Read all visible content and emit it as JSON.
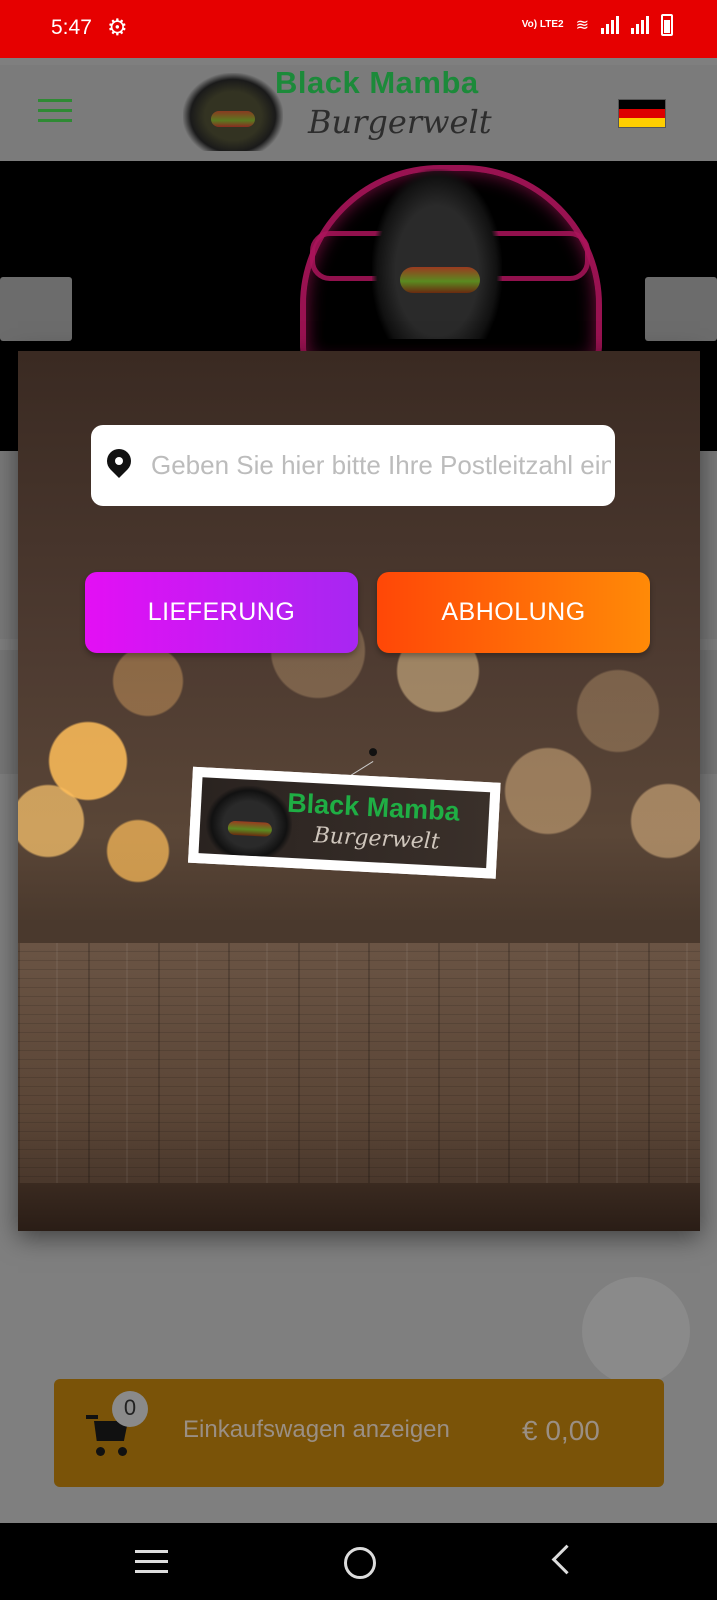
{
  "status_bar": {
    "time": "5:47",
    "settings_icon": "gear-icon",
    "volte_label": "Vo) LTE2",
    "icons": [
      "wifi-icon",
      "signal-icon",
      "signal-icon",
      "battery-icon"
    ]
  },
  "header": {
    "brand_name": "Black Mamba",
    "brand_subtitle": "Burgerwelt",
    "menu_icon": "hamburger-menu-icon",
    "language_flag": "german-flag-icon"
  },
  "modal": {
    "postcode_placeholder": "Geben Sie hier bitte Ihre Postleitzahl ein",
    "postcode_value": "",
    "delivery_label": "LIEFERUNG",
    "pickup_label": "ABHOLUNG",
    "sign_brand_name": "Black Mamba",
    "sign_brand_subtitle": "Burgerwelt"
  },
  "cart": {
    "count": "0",
    "label": "Einkaufswagen anzeigen",
    "total": "€ 0,00"
  },
  "colors": {
    "status_bar": "#e60000",
    "brand_green": "#1c8a3a",
    "delivery_gradient": [
      "#e40ff4",
      "#a727f2"
    ],
    "pickup_gradient": [
      "#ff4707",
      "#ff8a07"
    ],
    "cart_bar": "#7a5308"
  }
}
